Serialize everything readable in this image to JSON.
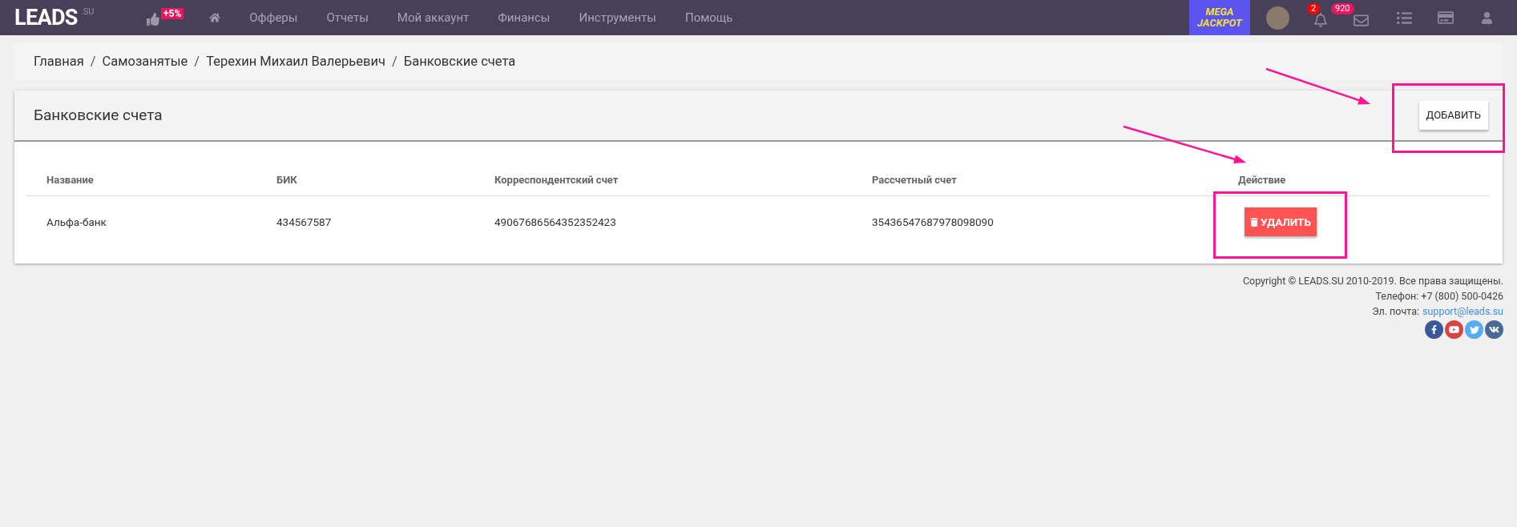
{
  "header": {
    "logo": "LEADS",
    "logo_suffix": ".SU",
    "bonus_badge": "+5%",
    "nav": [
      {
        "kind": "home"
      },
      {
        "kind": "link",
        "label": "Офферы"
      },
      {
        "kind": "link",
        "label": "Отчеты"
      },
      {
        "kind": "link",
        "label": "Мой аккаунт"
      },
      {
        "kind": "link",
        "label": "Финансы"
      },
      {
        "kind": "link",
        "label": "Инструменты"
      },
      {
        "kind": "link",
        "label": "Помощь"
      }
    ],
    "jackpot": [
      "MEGA",
      "JACKPOT"
    ],
    "notifications_count": "2",
    "messages_count": "920"
  },
  "breadcrumbs": [
    "Главная",
    "Самозанятые",
    "Терехин Михаил Валерьевич",
    "Банковские счета"
  ],
  "breadcrumb_separator": "/",
  "card": {
    "title": "Банковские счета",
    "add_button": "ДОБАВИТЬ",
    "columns": [
      "Название",
      "БИК",
      "Корреспондентский счет",
      "Рассчетный счет",
      "Действие"
    ],
    "rows": [
      {
        "cells": [
          "Альфа-банк",
          "434567587",
          "49067686564352352423",
          "35436547687978098090"
        ],
        "delete_button": "УДАЛИТЬ"
      }
    ]
  },
  "footer": {
    "copyright": "Copyright © LEADS.SU 2010-2019. Все права защищены.",
    "phone": "Телефон: +7 (800) 500-0426",
    "email_label": "Эл. почта:",
    "email": "support@leads.su"
  }
}
